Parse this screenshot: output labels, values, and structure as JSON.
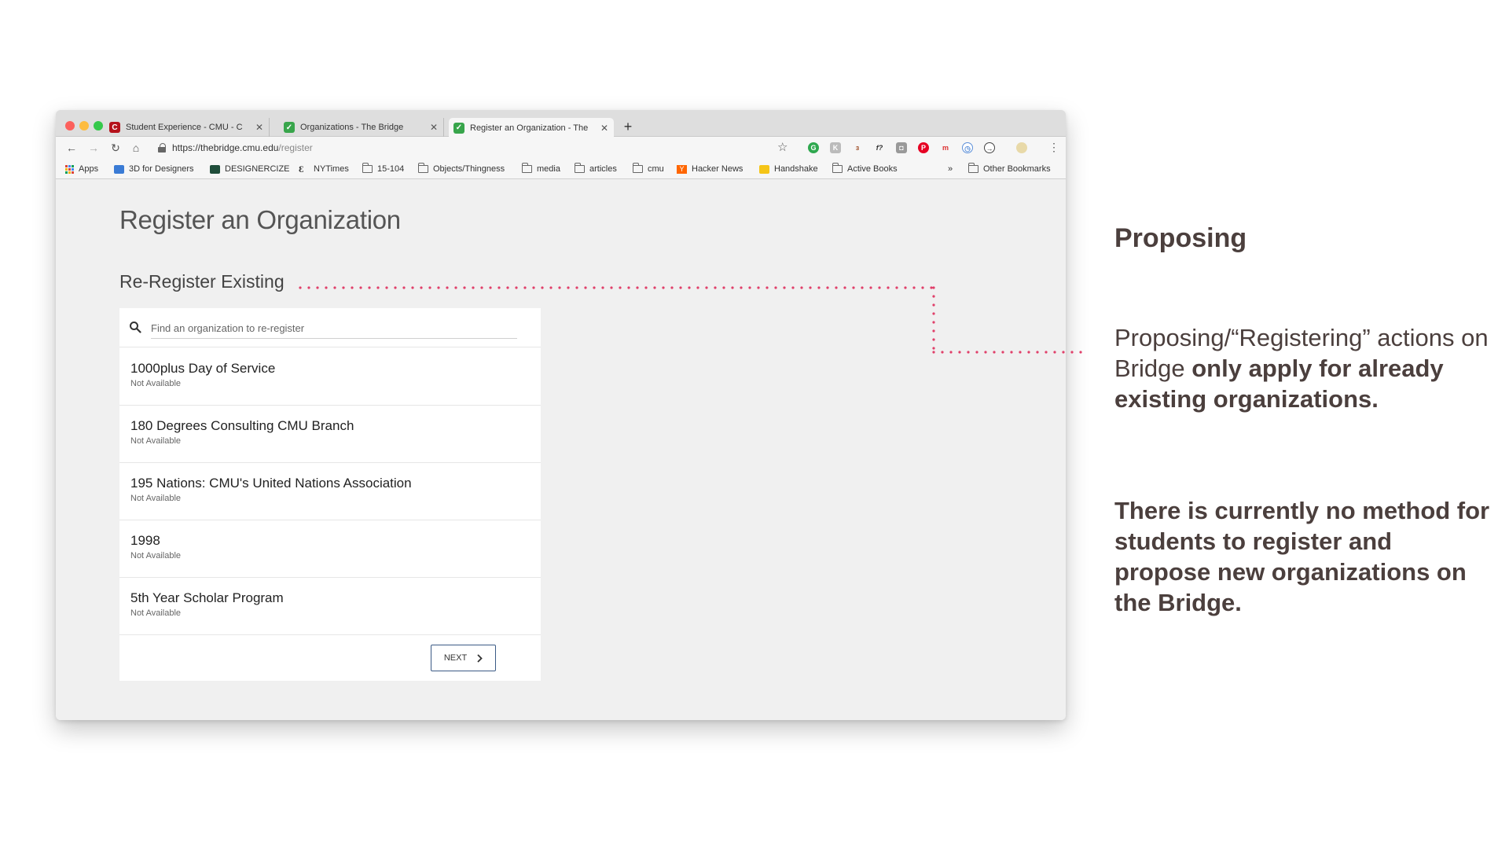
{
  "browser": {
    "tabs": [
      {
        "label": "Student Experience - CMU - C",
        "icon": "cmu-favicon",
        "active": false
      },
      {
        "label": "Organizations - The Bridge",
        "icon": "bridge-favicon",
        "active": false
      },
      {
        "label": "Register an Organization - The",
        "icon": "bridge-favicon",
        "active": true
      }
    ],
    "url_base": "https://thebridge.cmu.edu",
    "url_path": "/register",
    "bookmarks": [
      {
        "label": "Apps",
        "icon": "apps-grid-icon"
      },
      {
        "label": "3D for Designers",
        "icon": "bookmark-favicon"
      },
      {
        "label": "DESIGNERCIZE",
        "icon": "bookmark-favicon"
      },
      {
        "label": "NYTimes",
        "icon": "nytimes-icon"
      },
      {
        "label": "15-104",
        "icon": "folder-icon"
      },
      {
        "label": "Objects/Thingness",
        "icon": "folder-icon"
      },
      {
        "label": "media",
        "icon": "folder-icon"
      },
      {
        "label": "articles",
        "icon": "folder-icon"
      },
      {
        "label": "cmu",
        "icon": "folder-icon"
      },
      {
        "label": "Hacker News",
        "icon": "hacker-news-icon"
      },
      {
        "label": "Handshake",
        "icon": "handshake-icon"
      },
      {
        "label": "Active Books",
        "icon": "folder-icon"
      }
    ],
    "overflow_label": "»",
    "other_bookmarks": "Other Bookmarks"
  },
  "page": {
    "title": "Register an Organization",
    "section_title": "Re-Register Existing",
    "search_placeholder": "Find an organization to re-register",
    "organizations": [
      {
        "name": "1000plus Day of Service",
        "status": "Not Available"
      },
      {
        "name": "180 Degrees Consulting CMU Branch",
        "status": "Not Available"
      },
      {
        "name": "195 Nations: CMU's United Nations Association",
        "status": "Not Available"
      },
      {
        "name": "1998",
        "status": "Not Available"
      },
      {
        "name": "5th Year Scholar Program",
        "status": "Not Available"
      }
    ],
    "next_label": "NEXT"
  },
  "annotation": {
    "title": "Proposing",
    "text1_a": "Proposing/“Registering” actions on Bridge ",
    "text1_b": "only apply for already existing organizations.",
    "text2": "There is currently no method for students to register and propose new organizations on the Bridge.",
    "dot_color": "#e0406a",
    "text_color": "#4b3f3d"
  }
}
